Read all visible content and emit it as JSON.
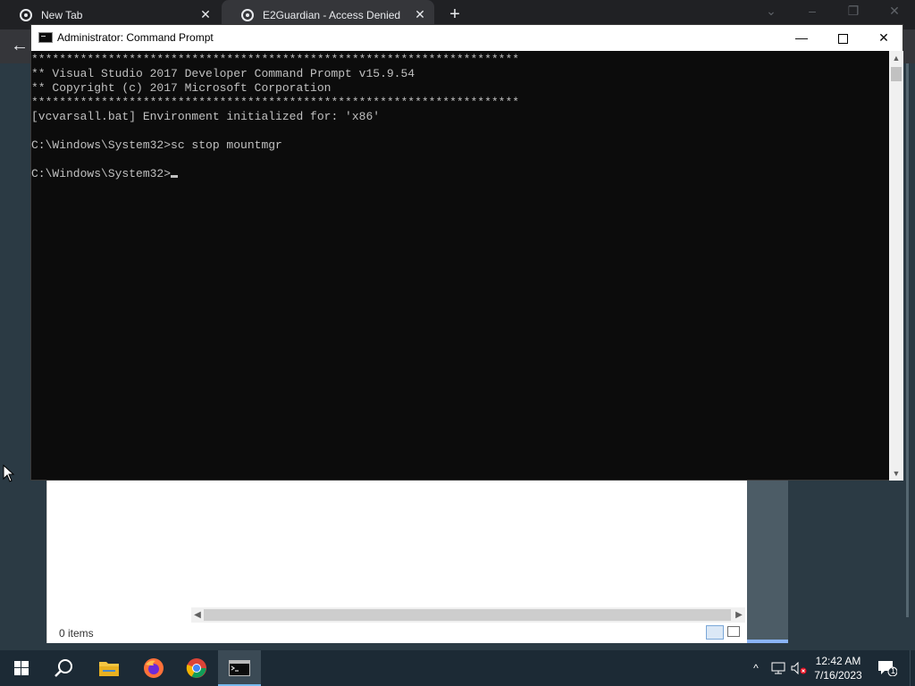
{
  "browser": {
    "tabs": [
      {
        "title": "New Tab",
        "close": "✕"
      },
      {
        "title": "E2Guardian - Access Denied",
        "close": "✕"
      }
    ],
    "new_tab": "+",
    "back": "←"
  },
  "explorer": {
    "status": "0 items"
  },
  "cmd": {
    "title": "Administrator:  Command Prompt",
    "lines": [
      "**********************************************************************",
      "** Visual Studio 2017 Developer Command Prompt v15.9.54",
      "** Copyright (c) 2017 Microsoft Corporation",
      "**********************************************************************",
      "[vcvarsall.bat] Environment initialized for: 'x86'",
      "",
      "C:\\Windows\\System32>sc stop mountmgr",
      "",
      "C:\\Windows\\System32>"
    ]
  },
  "taskbar": {
    "items": [
      "start-icon",
      "search-icon",
      "file-explorer-icon",
      "firefox-icon",
      "chrome-icon",
      "command-prompt-icon"
    ],
    "clock_time": "12:42 AM",
    "clock_date": "7/16/2023",
    "notification_count": "1"
  }
}
